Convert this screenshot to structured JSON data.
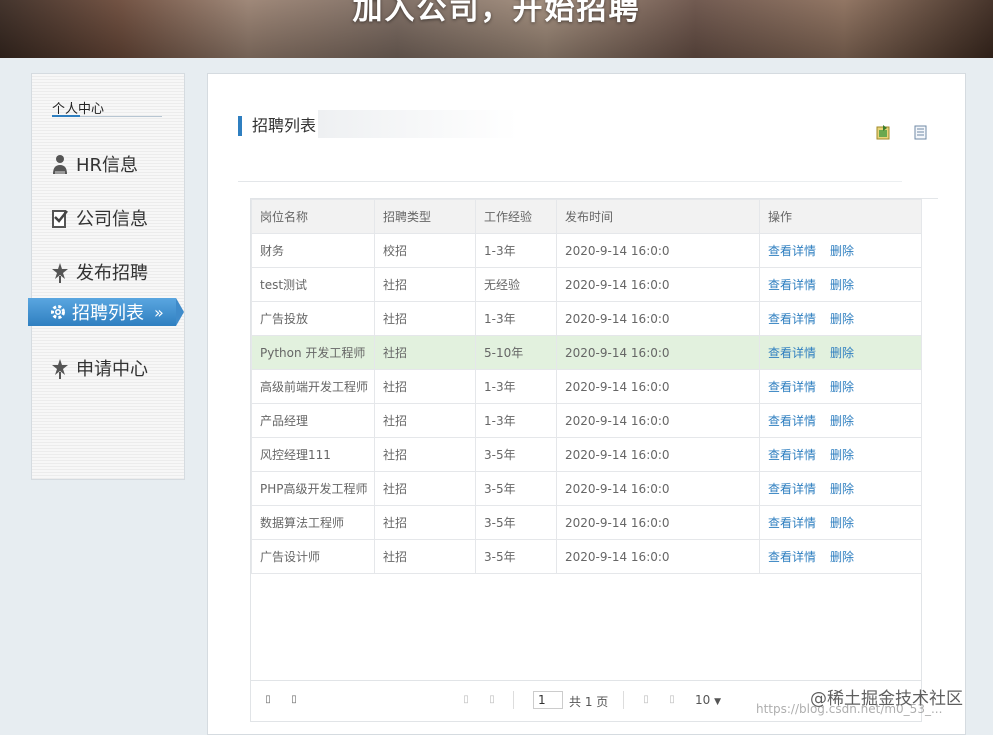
{
  "banner": {
    "title": "加入公司，开始招聘"
  },
  "sidebar": {
    "heading": "个人中心",
    "items": [
      {
        "label": "HR信息",
        "icon": "user-icon"
      },
      {
        "label": "公司信息",
        "icon": "checklist-icon"
      },
      {
        "label": "发布招聘",
        "icon": "pin-icon"
      },
      {
        "label": "招聘列表",
        "icon": "gear-icon",
        "active": true,
        "arrows": "»"
      },
      {
        "label": "申请中心",
        "icon": "pin-icon"
      }
    ]
  },
  "main": {
    "title": "招聘列表",
    "toolbar": {
      "export_icon": "export-excel-icon",
      "print_icon": "document-icon"
    },
    "table": {
      "headers": [
        "岗位名称",
        "招聘类型",
        "工作经验",
        "发布时间",
        "操作"
      ],
      "rows": [
        {
          "name": "财务",
          "type": "校招",
          "exp": "1-3年",
          "time": "2020-9-14 16:0:0",
          "view": "查看详情",
          "del": "删除"
        },
        {
          "name": "test测试",
          "type": "社招",
          "exp": "无经验",
          "time": "2020-9-14 16:0:0",
          "view": "查看详情",
          "del": "删除"
        },
        {
          "name": "广告投放",
          "type": "社招",
          "exp": "1-3年",
          "time": "2020-9-14 16:0:0",
          "view": "查看详情",
          "del": "删除"
        },
        {
          "name": "Python 开发工程师",
          "type": "社招",
          "exp": "5-10年",
          "time": "2020-9-14 16:0:0",
          "view": "查看详情",
          "del": "删除"
        },
        {
          "name": "高级前端开发工程师",
          "type": "社招",
          "exp": "1-3年",
          "time": "2020-9-14 16:0:0",
          "view": "查看详情",
          "del": "删除"
        },
        {
          "name": "产品经理",
          "type": "社招",
          "exp": "1-3年",
          "time": "2020-9-14 16:0:0",
          "view": "查看详情",
          "del": "删除"
        },
        {
          "name": "风控经理111",
          "type": "社招",
          "exp": "3-5年",
          "time": "2020-9-14 16:0:0",
          "view": "查看详情",
          "del": "删除"
        },
        {
          "name": "PHP高级开发工程师",
          "type": "社招",
          "exp": "3-5年",
          "time": "2020-9-14 16:0:0",
          "view": "查看详情",
          "del": "删除"
        },
        {
          "name": "数据算法工程师",
          "type": "社招",
          "exp": "3-5年",
          "time": "2020-9-14 16:0:0",
          "view": "查看详情",
          "del": "删除"
        },
        {
          "name": "广告设计师",
          "type": "社招",
          "exp": "3-5年",
          "time": "2020-9-14 16:0:0",
          "view": "查看详情",
          "del": "删除"
        }
      ],
      "highlighted_row": 3
    },
    "pager": {
      "page_value": "1",
      "total_text": "共 1 页",
      "page_size": "10",
      "page_size_caret": "▼",
      "first_glyph": "▯",
      "prev_glyph": "▯",
      "next_glyph": "▯",
      "last_glyph": "▯",
      "left1_glyph": "▯",
      "left2_glyph": "▯"
    }
  },
  "watermark": {
    "line1": "@稀土掘金技术社区",
    "line2": "https://blog.csdn.net/m0_53_..."
  },
  "colors": {
    "accent": "#2f7fc0",
    "highlight_row": "#e2f1de",
    "link": "#2f7fc0"
  }
}
